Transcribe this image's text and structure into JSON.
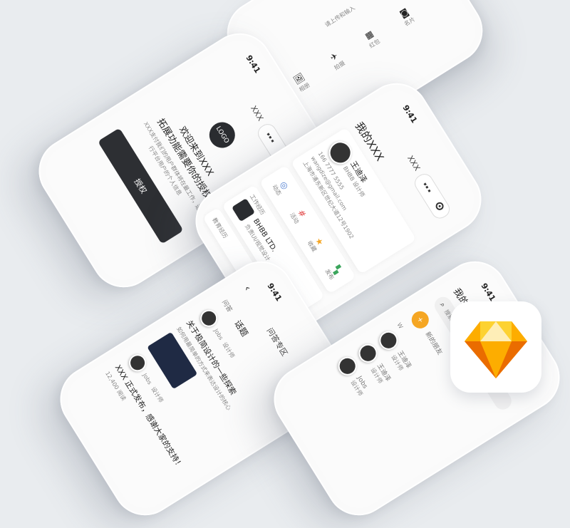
{
  "colors": {
    "background": "#e9ecef",
    "dark": "#2d2f33",
    "accent_orange": "#f5a623",
    "sketch_gold": "#fdb300"
  },
  "status_time": "9:41",
  "login": {
    "nav_title": "XXX",
    "logo_text": "LOGO",
    "welcome": "欢迎来到XXX",
    "subtitle": "拓展功能需要你的授权",
    "description": "XXX支付我们的用户群体将在最工作，运行平台用户的个人信息",
    "button": "授权"
  },
  "top_phone": {
    "hint": "请上传和输入",
    "items": [
      "相册",
      "拍摄",
      "红包",
      "名片"
    ]
  },
  "profile": {
    "title": "我的XXX",
    "nav_title": "XXX",
    "name": "王迪泽",
    "role": "BHBB 设计师",
    "phone": "166 7777 5555",
    "email": "wangdize@gmail.com",
    "address": "上海市浦东新区世纪大道12号1902",
    "quick": [
      "动态",
      "活动",
      "收藏",
      "发布"
    ],
    "quick_icons": [
      "globe-icon",
      "grid-icon",
      "star-icon",
      "apps-icon"
    ],
    "work_label": "工作经历",
    "company": "BHBB LTD.",
    "company_desc": "负责UI/视觉设计",
    "edu_label": "教育经历",
    "tabs": [
      "home-icon",
      "contact-icon",
      "gear-icon"
    ]
  },
  "community": {
    "tabs": [
      "问答",
      "话题"
    ],
    "title": "问答专区",
    "posts": [
      {
        "author": "Jobs",
        "role": "设计师",
        "headline": "关于极简设计的一些探索",
        "excerpt": "如何用最简单的方式来表达设计的核心"
      },
      {
        "author": "Jobs",
        "role": "设计师",
        "headline": "XXX 正式发布，感谢大家的支持！",
        "excerpt": "12,400 阅读"
      }
    ]
  },
  "contacts": {
    "search_placeholder": "搜索好友",
    "title": "我的",
    "new_friends": "新的朋友",
    "index_letter": "W",
    "people": [
      {
        "name": "王迪泽",
        "role": "设计师"
      },
      {
        "name": "王迪泽",
        "role": "设计师"
      },
      {
        "name": "Jobs",
        "role": "设计师"
      }
    ]
  }
}
